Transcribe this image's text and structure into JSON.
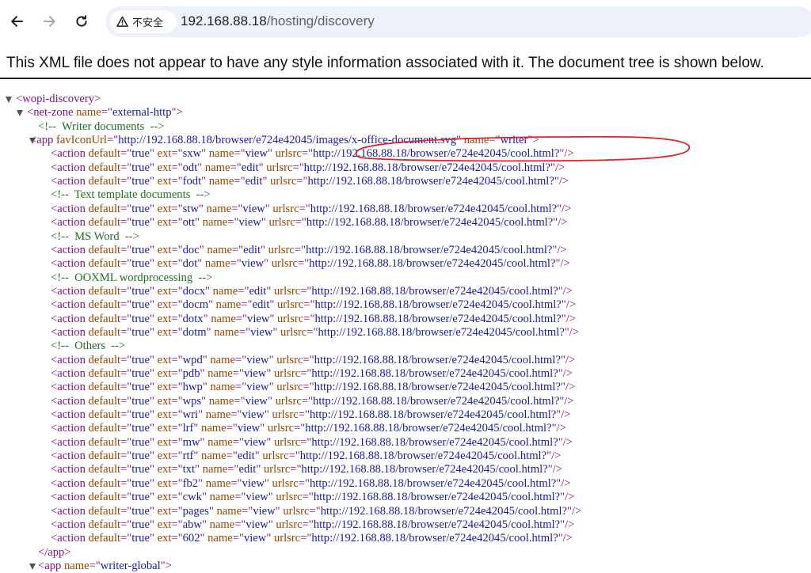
{
  "browser": {
    "security_label": "不安全",
    "url_host": "192.168.88.18",
    "url_path": "/hosting/discovery",
    "icons": [
      "back-arrow-icon",
      "forward-arrow-icon",
      "reload-icon",
      "warning-triangle-icon"
    ]
  },
  "xml_notice": "This XML file does not appear to have any style information associated with it. The document tree is shown below.",
  "tree": {
    "root_open": "wopi-discovery",
    "net_zone_name": "external-http",
    "comment_writer": "Writer documents",
    "app_favicon_url": "http://192.168.88.18/browser/e724e42045/images/x-office-document.svg",
    "app_name": "writer",
    "urlsrc": "http://192.168.88.18/browser/e724e42045/cool.html?",
    "actions": [
      {
        "type": "action",
        "ext": "sxw",
        "name": "view"
      },
      {
        "type": "action",
        "ext": "odt",
        "name": "edit"
      },
      {
        "type": "action",
        "ext": "fodt",
        "name": "edit"
      },
      {
        "type": "comment",
        "text": "Text template documents"
      },
      {
        "type": "action",
        "ext": "stw",
        "name": "view"
      },
      {
        "type": "action",
        "ext": "ott",
        "name": "view"
      },
      {
        "type": "comment",
        "text": "MS Word"
      },
      {
        "type": "action",
        "ext": "doc",
        "name": "edit"
      },
      {
        "type": "action",
        "ext": "dot",
        "name": "view"
      },
      {
        "type": "comment",
        "text": "OOXML wordprocessing"
      },
      {
        "type": "action",
        "ext": "docx",
        "name": "edit"
      },
      {
        "type": "action",
        "ext": "docm",
        "name": "edit"
      },
      {
        "type": "action",
        "ext": "dotx",
        "name": "view"
      },
      {
        "type": "action",
        "ext": "dotm",
        "name": "view"
      },
      {
        "type": "comment",
        "text": "Others"
      },
      {
        "type": "action",
        "ext": "wpd",
        "name": "view"
      },
      {
        "type": "action",
        "ext": "pdb",
        "name": "view"
      },
      {
        "type": "action",
        "ext": "hwp",
        "name": "view"
      },
      {
        "type": "action",
        "ext": "wps",
        "name": "view"
      },
      {
        "type": "action",
        "ext": "wri",
        "name": "view"
      },
      {
        "type": "action",
        "ext": "lrf",
        "name": "view"
      },
      {
        "type": "action",
        "ext": "mw",
        "name": "view"
      },
      {
        "type": "action",
        "ext": "rtf",
        "name": "edit"
      },
      {
        "type": "action",
        "ext": "txt",
        "name": "edit"
      },
      {
        "type": "action",
        "ext": "fb2",
        "name": "view"
      },
      {
        "type": "action",
        "ext": "cwk",
        "name": "view"
      },
      {
        "type": "action",
        "ext": "pages",
        "name": "view"
      },
      {
        "type": "action",
        "ext": "abw",
        "name": "view"
      },
      {
        "type": "action",
        "ext": "602",
        "name": "view"
      }
    ],
    "app_close": "app",
    "next_app_name": "writer-global"
  },
  "colors": {
    "tag": "#881280",
    "attr_name": "#994500",
    "attr_value": "#1a1aa6",
    "comment": "#236e25",
    "annotation_circle": "#d9262b"
  }
}
